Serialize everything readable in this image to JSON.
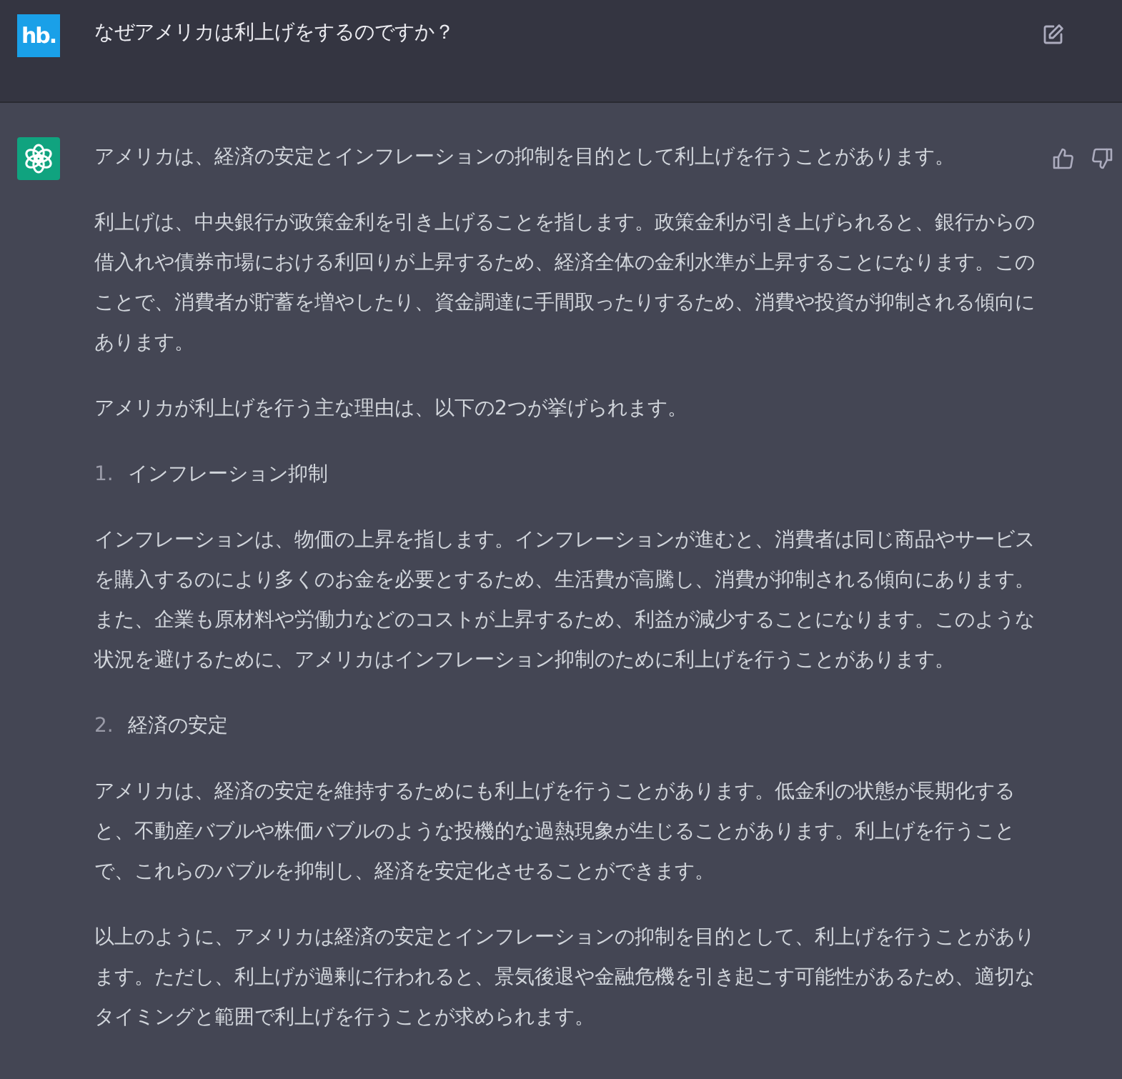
{
  "user_message": {
    "avatar_text": "hb.",
    "text": "なぜアメリカは利上げをするのですか？"
  },
  "assistant_message": {
    "blocks": [
      {
        "kind": "paragraph",
        "text": "アメリカは、経済の安定とインフレーションの抑制を目的として利上げを行うことがあります。"
      },
      {
        "kind": "paragraph",
        "text": "利上げは、中央銀行が政策金利を引き上げることを指します。政策金利が引き上げられると、銀行からの借入れや債券市場における利回りが上昇するため、経済全体の金利水準が上昇することになります。このことで、消費者が貯蓄を増やしたり、資金調達に手間取ったりするため、消費や投資が抑制される傾向にあります。"
      },
      {
        "kind": "paragraph",
        "text": "アメリカが利上げを行う主な理由は、以下の2つが挙げられます。"
      },
      {
        "kind": "list_item",
        "number": "1.",
        "text": "インフレーション抑制"
      },
      {
        "kind": "paragraph",
        "text": "インフレーションは、物価の上昇を指します。インフレーションが進むと、消費者は同じ商品やサービスを購入するのにより多くのお金を必要とするため、生活費が高騰し、消費が抑制される傾向にあります。また、企業も原材料や労働力などのコストが上昇するため、利益が減少することになります。このような状況を避けるために、アメリカはインフレーション抑制のために利上げを行うことがあります。"
      },
      {
        "kind": "list_item",
        "number": "2.",
        "text": "経済の安定"
      },
      {
        "kind": "paragraph",
        "text": "アメリカは、経済の安定を維持するためにも利上げを行うことがあります。低金利の状態が長期化すると、不動産バブルや株価バブルのような投機的な過熱現象が生じることがあります。利上げを行うことで、これらのバブルを抑制し、経済を安定化させることができます。"
      },
      {
        "kind": "paragraph",
        "text": "以上のように、アメリカは経済の安定とインフレーションの抑制を目的として、利上げを行うことがあります。ただし、利上げが過剰に行われると、景気後退や金融危機を引き起こす可能性があるため、適切なタイミングと範囲で利上げを行うことが求められます。"
      }
    ]
  }
}
